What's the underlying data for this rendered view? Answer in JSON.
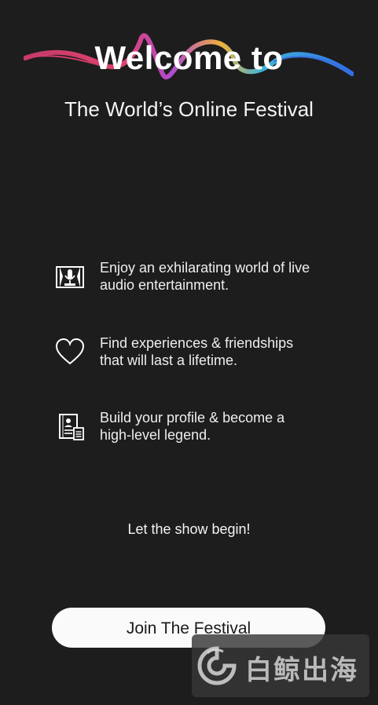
{
  "header": {
    "title": "Welcome to",
    "subtitle": "The World’s Online Festival"
  },
  "features": [
    {
      "icon": "microphone-stage-icon",
      "text_line1": "Enjoy an exhilarating world of live",
      "text_line2": "audio entertainment."
    },
    {
      "icon": "heart-icon",
      "text_line1": "Find experiences & friendships",
      "text_line2": "that will last a lifetime."
    },
    {
      "icon": "profile-document-icon",
      "text_line1": "Build your profile & become a",
      "text_line2": "high-level legend."
    }
  ],
  "tagline": "Let the show begin!",
  "cta": {
    "join_label": "Join The Festival"
  },
  "watermark": {
    "text": "白鲸出海",
    "icon": "whale-logo-icon"
  },
  "colors": {
    "background": "#1d1d1d",
    "wave_gradient": [
      "#d63a7a",
      "#e0446e",
      "#f0b13a",
      "#3fb6d8",
      "#2f6ee6"
    ]
  }
}
